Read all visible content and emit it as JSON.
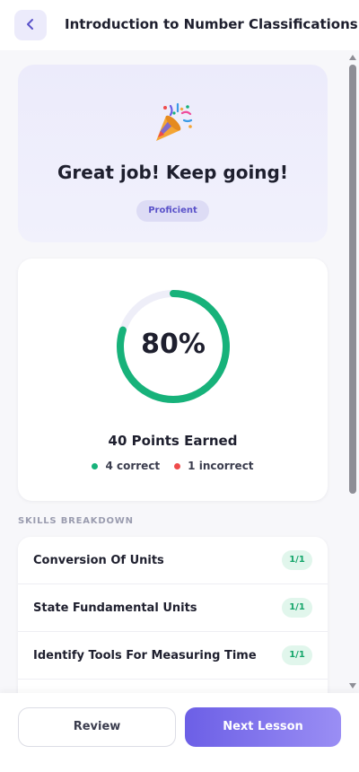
{
  "header": {
    "title": "Introduction to Number Classifications",
    "back_icon": "chevron-left-icon"
  },
  "result": {
    "celebration_icon": "party-popper-icon",
    "message": "Great job! Keep going!",
    "level_badge": "Proficient"
  },
  "score": {
    "percent_label": "80%",
    "percent_value": 0.8,
    "points_label": "40 Points Earned",
    "correct_label": "4 correct",
    "incorrect_label": "1 incorrect"
  },
  "skills": {
    "section_label": "SKILLS BREAKDOWN",
    "items": [
      {
        "name": "Conversion Of Units",
        "score": "1/1"
      },
      {
        "name": "State Fundamental Units",
        "score": "1/1"
      },
      {
        "name": "Identify Tools For Measuring Time",
        "score": "1/1"
      }
    ]
  },
  "footer": {
    "review_label": "Review",
    "next_label": "Next Lesson"
  },
  "colors": {
    "accent": "#6c5fe6",
    "correct": "#17b27a",
    "incorrect": "#ef4b4b",
    "ring_track": "#eeeef8"
  }
}
